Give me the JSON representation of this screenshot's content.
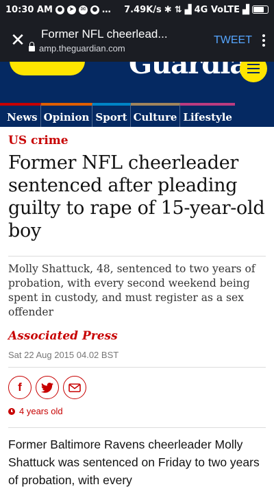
{
  "status_bar": {
    "time": "10:30 AM",
    "speed": "7.49K/s",
    "network": "4G VoLTE"
  },
  "toolbar": {
    "page_title": "Former NFL cheerlead...",
    "url": "amp.theguardian.com",
    "tweet_label": "TWEET",
    "close_symbol": "✕"
  },
  "header": {
    "logo_text": "Guardian"
  },
  "nav": {
    "items": [
      {
        "label": "News",
        "color": "#c70000"
      },
      {
        "label": "Opinion",
        "color": "#e05e00"
      },
      {
        "label": "Sport",
        "color": "#0084c6"
      },
      {
        "label": "Culture",
        "color": "#a1845c"
      },
      {
        "label": "Lifestyle",
        "color": "#bb3b80"
      }
    ]
  },
  "article": {
    "kicker": "US crime",
    "headline": "Former NFL cheerleader sentenced after pleading guilty to rape of 15-year-old boy",
    "standfirst": "Molly Shattuck, 48, sentenced to two years of probation, with every second weekend being spent in custody, and must register as a sex offender",
    "byline": "Associated Press",
    "dateline": "Sat 22 Aug 2015 04.02 BST",
    "age": "4 years old",
    "body": "Former Baltimore Ravens cheerleader Molly Shattuck was sentenced on Friday to two years of probation, with every"
  },
  "share": {
    "facebook_glyph": "f",
    "twitter_icon": "twitter-bird",
    "email_icon": "envelope"
  },
  "colors": {
    "guardian_blue": "#052962",
    "guardian_red": "#c70000",
    "guardian_yellow": "#ffe500",
    "chrome_bar": "#1b1d23",
    "link_blue": "#56a6ff"
  }
}
